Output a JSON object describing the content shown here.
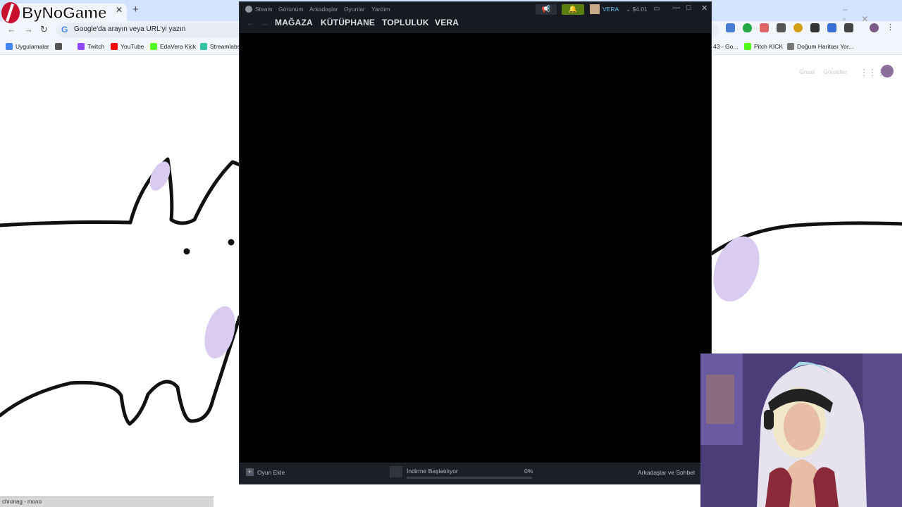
{
  "overlay": {
    "logo_text": "ByNoGame"
  },
  "chrome": {
    "new_tab_glyph": "+",
    "omnibox_placeholder": "Google'da arayın veya URL'yi yazın",
    "bookmarks": [
      {
        "label": "Uygulamalar",
        "color": "#4285f4"
      },
      {
        "label": "",
        "color": "#555555"
      },
      {
        "label": "Twitch",
        "color": "#9146ff"
      },
      {
        "label": "YouTube",
        "color": "#ff0000"
      },
      {
        "label": "EdaVera Kick",
        "color": "#53fc18"
      },
      {
        "label": "Streamlabs",
        "color": "#31c3a2"
      },
      {
        "label": "43 - Go...",
        "color": "#cccccc"
      },
      {
        "label": "Pitch KICK",
        "color": "#53fc18"
      },
      {
        "label": "Doğum Haritası Yor...",
        "color": "#777777"
      }
    ],
    "google_links": [
      "Gmail",
      "Görseller"
    ],
    "status_text": "chronag - mono"
  },
  "steam": {
    "menu": [
      "Steam",
      "Görünüm",
      "Arkadaşlar",
      "Oyunlar",
      "Yardım"
    ],
    "account_name": "VERA",
    "wallet": "$4.01",
    "nav_tabs": [
      "MAĞAZA",
      "KÜTÜPHANE",
      "TOPLULUK",
      "VERA"
    ],
    "footer": {
      "add_game": "Oyun Ekle",
      "download_status": "İndirme Başlatılıyor",
      "download_percent": "0%",
      "download_progress": 0,
      "friends_chat": "Arkadaşlar ve Sohbet"
    },
    "colors": {
      "accent": "#66c0f4",
      "notification": "#5c7e10",
      "background": "#171a21"
    }
  }
}
